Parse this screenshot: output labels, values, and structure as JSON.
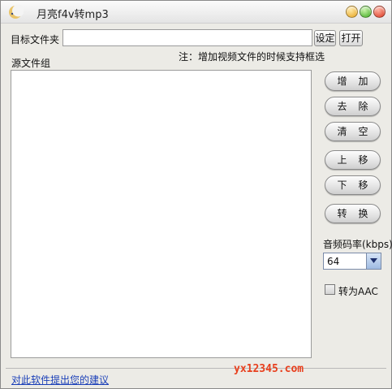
{
  "window": {
    "title": "月亮f4v转mp3"
  },
  "target_folder": {
    "label": "目标文件夹",
    "value": "",
    "set_label": "设定",
    "open_label": "打开"
  },
  "note": "注：增加视频文件的时候支持框选",
  "source_group": {
    "label": "源文件组",
    "items": []
  },
  "buttons": {
    "add": "增加",
    "remove": "去除",
    "clear": "清空",
    "move_up": "上移",
    "move_down": "下移",
    "convert": "转换"
  },
  "bitrate": {
    "label": "音频码率(kbps)",
    "selected": "64"
  },
  "aac": {
    "label": "转为AAC",
    "checked": false
  },
  "footer": {
    "suggest_link": "对此软件提出您的建议",
    "watermark": "yx12345.com"
  }
}
